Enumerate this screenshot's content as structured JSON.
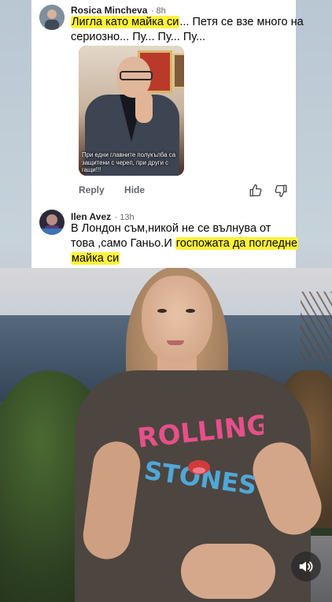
{
  "comments": [
    {
      "author": "Rosica Mincheva",
      "time": "· 8h",
      "text_highlight": "Лигла като майка си",
      "text_rest_line1": "... Петя се взе много на",
      "text_line2": "сериозно... Пу... Пу... Пу...",
      "media_caption": "При едни главните полукълба са защитени с череп, при други с гащи!!!",
      "reply_label": "Reply",
      "hide_label": "Hide"
    },
    {
      "author": "Ilen Avez",
      "time": "· 13h",
      "text_line1": "В Лондон съм,никой не се вълнува от",
      "text_line2_plain": "това ,само Ганьо.И ",
      "text_line2_highlight": "госпожата да погледне",
      "text_line3_highlight": "майка си"
    }
  ],
  "video": {
    "shirt_print_line1": "ROLLING",
    "shirt_print_line2": "STONES"
  },
  "icons": {
    "like": "thumbs-up-icon",
    "dislike": "thumbs-down-icon",
    "volume": "speaker-icon"
  },
  "colors": {
    "highlight": "#fff23a",
    "meta_gray": "#65676b"
  }
}
